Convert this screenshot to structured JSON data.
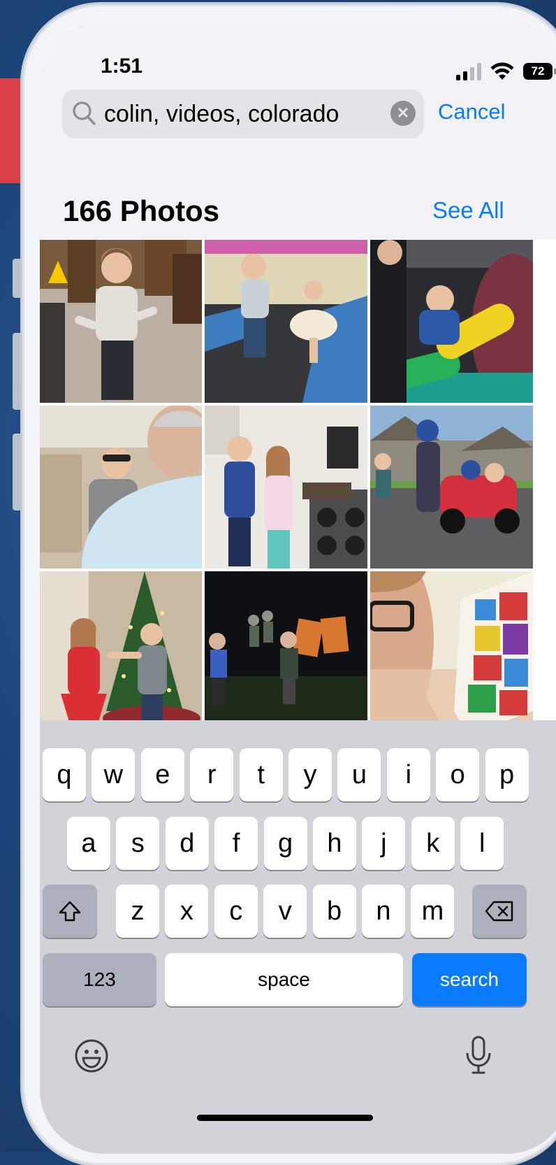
{
  "status_bar": {
    "time": "1:51",
    "battery": "72"
  },
  "search": {
    "query": "colin, videos, colorado",
    "cancel_label": "Cancel"
  },
  "results": {
    "title": "166 Photos",
    "see_all_label": "See All",
    "photos": [
      {
        "description": "boy in Husky shirt dancing in restaurant"
      },
      {
        "description": "boy and girl jumping on trampoline"
      },
      {
        "description": "boy on yellow padded bar"
      },
      {
        "description": "boy in car back seat"
      },
      {
        "description": "kids in kitchen by stove"
      },
      {
        "description": "kids with ride-on car on street"
      },
      {
        "description": "kids by Christmas tree"
      },
      {
        "description": "kids playing in yard at night"
      },
      {
        "description": "boy reading comic book"
      }
    ]
  },
  "keyboard": {
    "row1": [
      "q",
      "w",
      "e",
      "r",
      "t",
      "y",
      "u",
      "i",
      "o",
      "p"
    ],
    "row2": [
      "a",
      "s",
      "d",
      "f",
      "g",
      "h",
      "j",
      "k",
      "l"
    ],
    "row3": [
      "z",
      "x",
      "c",
      "v",
      "b",
      "n",
      "m"
    ],
    "numbers_label": "123",
    "space_label": "space",
    "search_label": "search"
  },
  "colors": {
    "accent": "#0a7bff",
    "arrow": "#d94047"
  }
}
